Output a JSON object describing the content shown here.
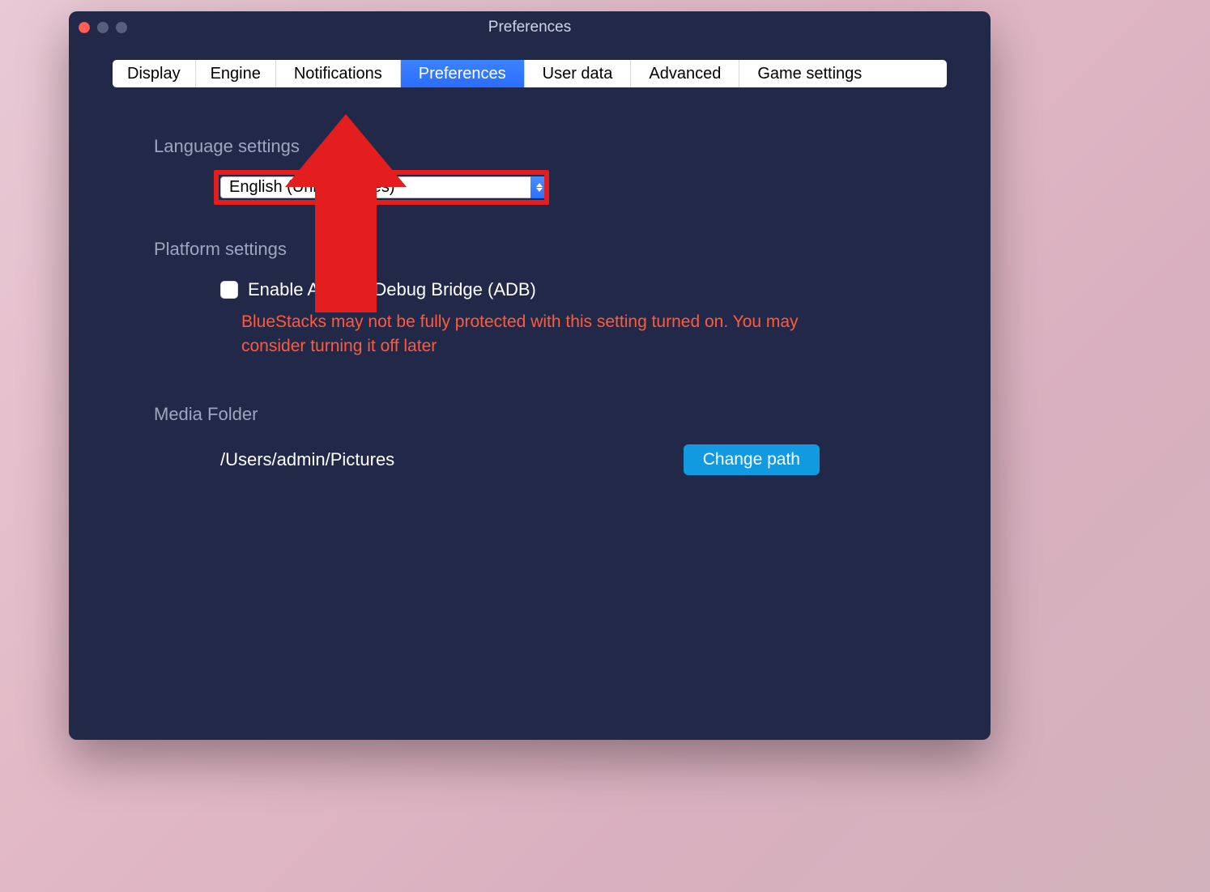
{
  "window": {
    "title": "Preferences"
  },
  "tabs": {
    "t0": "Display",
    "t1": "Engine",
    "t2": "Notifications",
    "t3": "Preferences",
    "t4": "User data",
    "t5": "Advanced",
    "t6": "Game settings",
    "active_index": 3
  },
  "language": {
    "label": "Language settings",
    "selected": "English (United States)"
  },
  "platform": {
    "label": "Platform settings",
    "adb_label": "Enable Android Debug Bridge (ADB)",
    "adb_checked": false,
    "warning": "BlueStacks may not be fully protected with this setting turned on. You may consider turning it off later"
  },
  "media": {
    "label": "Media Folder",
    "path": "/Users/admin/Pictures",
    "change_label": "Change path"
  },
  "annotation": {
    "type": "red-up-arrow",
    "points_to": "language-dropdown"
  }
}
